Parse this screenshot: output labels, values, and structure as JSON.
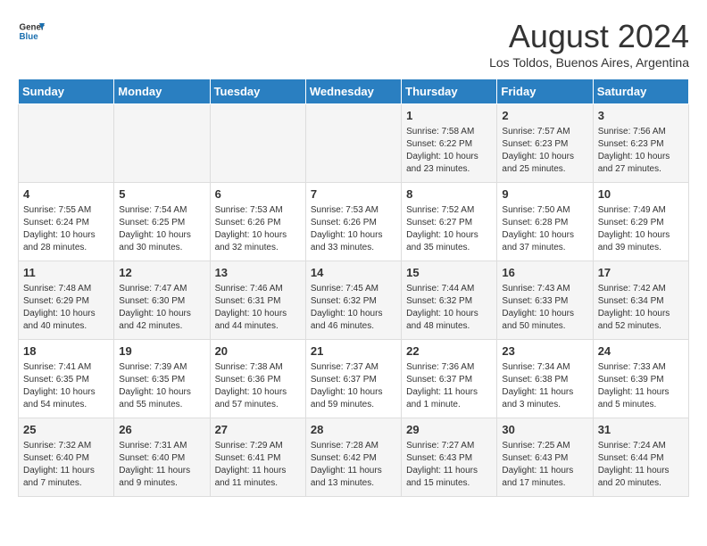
{
  "logo": {
    "general": "General",
    "blue": "Blue"
  },
  "header": {
    "month_year": "August 2024",
    "location": "Los Toldos, Buenos Aires, Argentina"
  },
  "days_of_week": [
    "Sunday",
    "Monday",
    "Tuesday",
    "Wednesday",
    "Thursday",
    "Friday",
    "Saturday"
  ],
  "weeks": [
    [
      {
        "day": "",
        "info": ""
      },
      {
        "day": "",
        "info": ""
      },
      {
        "day": "",
        "info": ""
      },
      {
        "day": "",
        "info": ""
      },
      {
        "day": "1",
        "info": "Sunrise: 7:58 AM\nSunset: 6:22 PM\nDaylight: 10 hours and 23 minutes."
      },
      {
        "day": "2",
        "info": "Sunrise: 7:57 AM\nSunset: 6:23 PM\nDaylight: 10 hours and 25 minutes."
      },
      {
        "day": "3",
        "info": "Sunrise: 7:56 AM\nSunset: 6:23 PM\nDaylight: 10 hours and 27 minutes."
      }
    ],
    [
      {
        "day": "4",
        "info": "Sunrise: 7:55 AM\nSunset: 6:24 PM\nDaylight: 10 hours and 28 minutes."
      },
      {
        "day": "5",
        "info": "Sunrise: 7:54 AM\nSunset: 6:25 PM\nDaylight: 10 hours and 30 minutes."
      },
      {
        "day": "6",
        "info": "Sunrise: 7:53 AM\nSunset: 6:26 PM\nDaylight: 10 hours and 32 minutes."
      },
      {
        "day": "7",
        "info": "Sunrise: 7:53 AM\nSunset: 6:26 PM\nDaylight: 10 hours and 33 minutes."
      },
      {
        "day": "8",
        "info": "Sunrise: 7:52 AM\nSunset: 6:27 PM\nDaylight: 10 hours and 35 minutes."
      },
      {
        "day": "9",
        "info": "Sunrise: 7:50 AM\nSunset: 6:28 PM\nDaylight: 10 hours and 37 minutes."
      },
      {
        "day": "10",
        "info": "Sunrise: 7:49 AM\nSunset: 6:29 PM\nDaylight: 10 hours and 39 minutes."
      }
    ],
    [
      {
        "day": "11",
        "info": "Sunrise: 7:48 AM\nSunset: 6:29 PM\nDaylight: 10 hours and 40 minutes."
      },
      {
        "day": "12",
        "info": "Sunrise: 7:47 AM\nSunset: 6:30 PM\nDaylight: 10 hours and 42 minutes."
      },
      {
        "day": "13",
        "info": "Sunrise: 7:46 AM\nSunset: 6:31 PM\nDaylight: 10 hours and 44 minutes."
      },
      {
        "day": "14",
        "info": "Sunrise: 7:45 AM\nSunset: 6:32 PM\nDaylight: 10 hours and 46 minutes."
      },
      {
        "day": "15",
        "info": "Sunrise: 7:44 AM\nSunset: 6:32 PM\nDaylight: 10 hours and 48 minutes."
      },
      {
        "day": "16",
        "info": "Sunrise: 7:43 AM\nSunset: 6:33 PM\nDaylight: 10 hours and 50 minutes."
      },
      {
        "day": "17",
        "info": "Sunrise: 7:42 AM\nSunset: 6:34 PM\nDaylight: 10 hours and 52 minutes."
      }
    ],
    [
      {
        "day": "18",
        "info": "Sunrise: 7:41 AM\nSunset: 6:35 PM\nDaylight: 10 hours and 54 minutes."
      },
      {
        "day": "19",
        "info": "Sunrise: 7:39 AM\nSunset: 6:35 PM\nDaylight: 10 hours and 55 minutes."
      },
      {
        "day": "20",
        "info": "Sunrise: 7:38 AM\nSunset: 6:36 PM\nDaylight: 10 hours and 57 minutes."
      },
      {
        "day": "21",
        "info": "Sunrise: 7:37 AM\nSunset: 6:37 PM\nDaylight: 10 hours and 59 minutes."
      },
      {
        "day": "22",
        "info": "Sunrise: 7:36 AM\nSunset: 6:37 PM\nDaylight: 11 hours and 1 minute."
      },
      {
        "day": "23",
        "info": "Sunrise: 7:34 AM\nSunset: 6:38 PM\nDaylight: 11 hours and 3 minutes."
      },
      {
        "day": "24",
        "info": "Sunrise: 7:33 AM\nSunset: 6:39 PM\nDaylight: 11 hours and 5 minutes."
      }
    ],
    [
      {
        "day": "25",
        "info": "Sunrise: 7:32 AM\nSunset: 6:40 PM\nDaylight: 11 hours and 7 minutes."
      },
      {
        "day": "26",
        "info": "Sunrise: 7:31 AM\nSunset: 6:40 PM\nDaylight: 11 hours and 9 minutes."
      },
      {
        "day": "27",
        "info": "Sunrise: 7:29 AM\nSunset: 6:41 PM\nDaylight: 11 hours and 11 minutes."
      },
      {
        "day": "28",
        "info": "Sunrise: 7:28 AM\nSunset: 6:42 PM\nDaylight: 11 hours and 13 minutes."
      },
      {
        "day": "29",
        "info": "Sunrise: 7:27 AM\nSunset: 6:43 PM\nDaylight: 11 hours and 15 minutes."
      },
      {
        "day": "30",
        "info": "Sunrise: 7:25 AM\nSunset: 6:43 PM\nDaylight: 11 hours and 17 minutes."
      },
      {
        "day": "31",
        "info": "Sunrise: 7:24 AM\nSunset: 6:44 PM\nDaylight: 11 hours and 20 minutes."
      }
    ]
  ]
}
